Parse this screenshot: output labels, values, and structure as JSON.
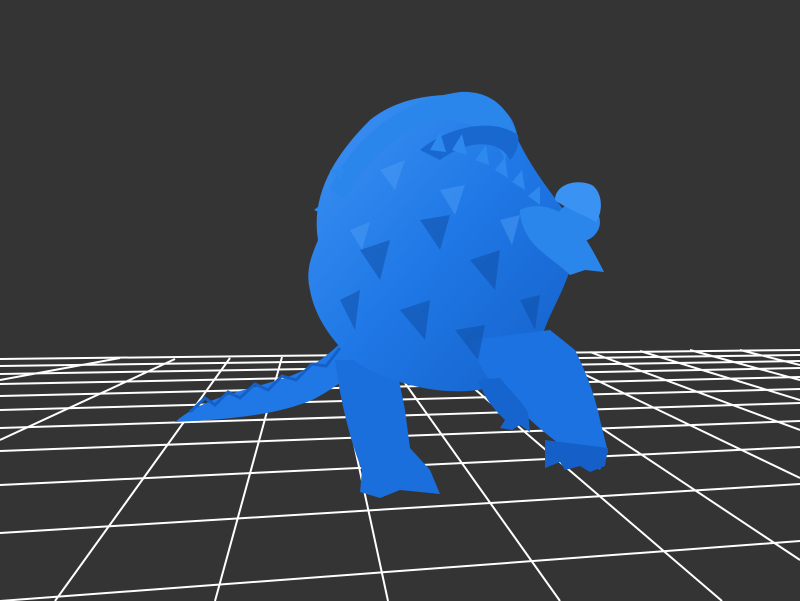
{
  "scene": {
    "background_color": "#343434",
    "grid_color": "#ffffff",
    "model_color": "#1f78e6",
    "model_shadow_color": "#0f4fa6",
    "model_highlight_color": "#4d9cf5",
    "model_icon": "creature-mesh-icon"
  }
}
